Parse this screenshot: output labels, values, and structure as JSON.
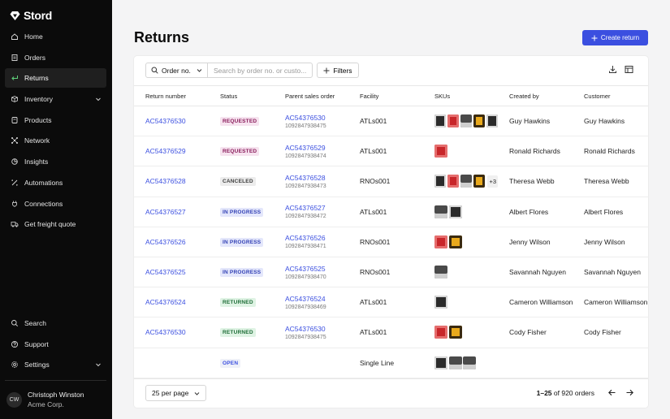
{
  "brand": {
    "name": "Stord"
  },
  "sidebar": {
    "items": [
      {
        "label": "Home",
        "icon": "home-icon"
      },
      {
        "label": "Orders",
        "icon": "clipboard-icon"
      },
      {
        "label": "Returns",
        "icon": "return-arrow-icon",
        "active": true
      },
      {
        "label": "Inventory",
        "icon": "box-icon",
        "expandable": true
      },
      {
        "label": "Products",
        "icon": "tag-icon"
      },
      {
        "label": "Network",
        "icon": "network-icon"
      },
      {
        "label": "Insights",
        "icon": "insights-icon"
      },
      {
        "label": "Automations",
        "icon": "automation-icon"
      },
      {
        "label": "Connections",
        "icon": "plug-icon"
      },
      {
        "label": "Get freight quote",
        "icon": "truck-icon"
      }
    ],
    "bottom_items": [
      {
        "label": "Search",
        "icon": "search-icon"
      },
      {
        "label": "Support",
        "icon": "help-icon"
      },
      {
        "label": "Settings",
        "icon": "gear-icon",
        "expandable": true
      }
    ],
    "user": {
      "initials": "CW",
      "name": "Christoph Winston",
      "org": "Acme Corp."
    }
  },
  "page": {
    "title": "Returns",
    "create_button": "Create return"
  },
  "toolbar": {
    "search_field": "Order no.",
    "search_placeholder": "Search by order no. or custo...",
    "filters_label": "Filters"
  },
  "table": {
    "columns": [
      "Return number",
      "Status",
      "Parent sales order",
      "Facility",
      "SKUs",
      "Created by",
      "Customer"
    ],
    "rows": [
      {
        "return_number": "AC54376530",
        "status": "REQUESTED",
        "status_kind": "requested",
        "order": "AC54376530",
        "order_sub": "1092847938475",
        "facility": "ATLs001",
        "skus": [
          "s1",
          "s2",
          "s3",
          "s4",
          "s1"
        ],
        "more": "",
        "created_by": "Guy Hawkins",
        "customer": "Guy Hawkins"
      },
      {
        "return_number": "AC54376529",
        "status": "REQUESTED",
        "status_kind": "requested",
        "order": "AC54376529",
        "order_sub": "1092847938474",
        "facility": "ATLs001",
        "skus": [
          "s2"
        ],
        "more": "",
        "created_by": "Ronald Richards",
        "customer": "Ronald Richards"
      },
      {
        "return_number": "AC54376528",
        "status": "CANCELED",
        "status_kind": "canceled",
        "order": "AC54376528",
        "order_sub": "1092847938473",
        "facility": "RNOs001",
        "skus": [
          "s1",
          "s2",
          "s3",
          "s4"
        ],
        "more": "+3",
        "created_by": "Theresa Webb",
        "customer": "Theresa Webb"
      },
      {
        "return_number": "AC54376527",
        "status": "IN PROGRESS",
        "status_kind": "progress",
        "order": "AC54376527",
        "order_sub": "1092847938472",
        "facility": "ATLs001",
        "skus": [
          "s3",
          "s1"
        ],
        "more": "",
        "created_by": "Albert Flores",
        "customer": "Albert Flores"
      },
      {
        "return_number": "AC54376526",
        "status": "IN PROGRESS",
        "status_kind": "progress",
        "order": "AC54376526",
        "order_sub": "1092847938471",
        "facility": "RNOs001",
        "skus": [
          "s2",
          "s4"
        ],
        "more": "",
        "created_by": "Jenny Wilson",
        "customer": "Jenny Wilson"
      },
      {
        "return_number": "AC54376525",
        "status": "IN PROGRESS",
        "status_kind": "progress",
        "order": "AC54376525",
        "order_sub": "1092847938470",
        "facility": "RNOs001",
        "skus": [
          "s3"
        ],
        "more": "",
        "created_by": "Savannah Nguyen",
        "customer": "Savannah Nguyen"
      },
      {
        "return_number": "AC54376524",
        "status": "RETURNED",
        "status_kind": "returned",
        "order": "AC54376524",
        "order_sub": "1092847938469",
        "facility": "ATLs001",
        "skus": [
          "s1"
        ],
        "more": "",
        "created_by": "Cameron Williamson",
        "customer": "Cameron Williamson"
      },
      {
        "return_number": "AC54376530",
        "status": "RETURNED",
        "status_kind": "returned",
        "order": "AC54376530",
        "order_sub": "1092847938475",
        "facility": "ATLs001",
        "skus": [
          "s2",
          "s4"
        ],
        "more": "",
        "created_by": "Cody Fisher",
        "customer": "Cody Fisher"
      },
      {
        "return_number": "",
        "status": "OPEN",
        "status_kind": "open",
        "order": "",
        "order_sub": "",
        "facility": "Single Line",
        "skus": [
          "s1",
          "s3",
          "s3"
        ],
        "more": "",
        "created_by": "",
        "customer": ""
      }
    ]
  },
  "footer": {
    "per_page": "25 per page",
    "range": "1–25",
    "of_text": "of 920 orders"
  },
  "colors": {
    "accent": "#3b4fe0",
    "sidebar_bg": "#0b0b0b"
  }
}
